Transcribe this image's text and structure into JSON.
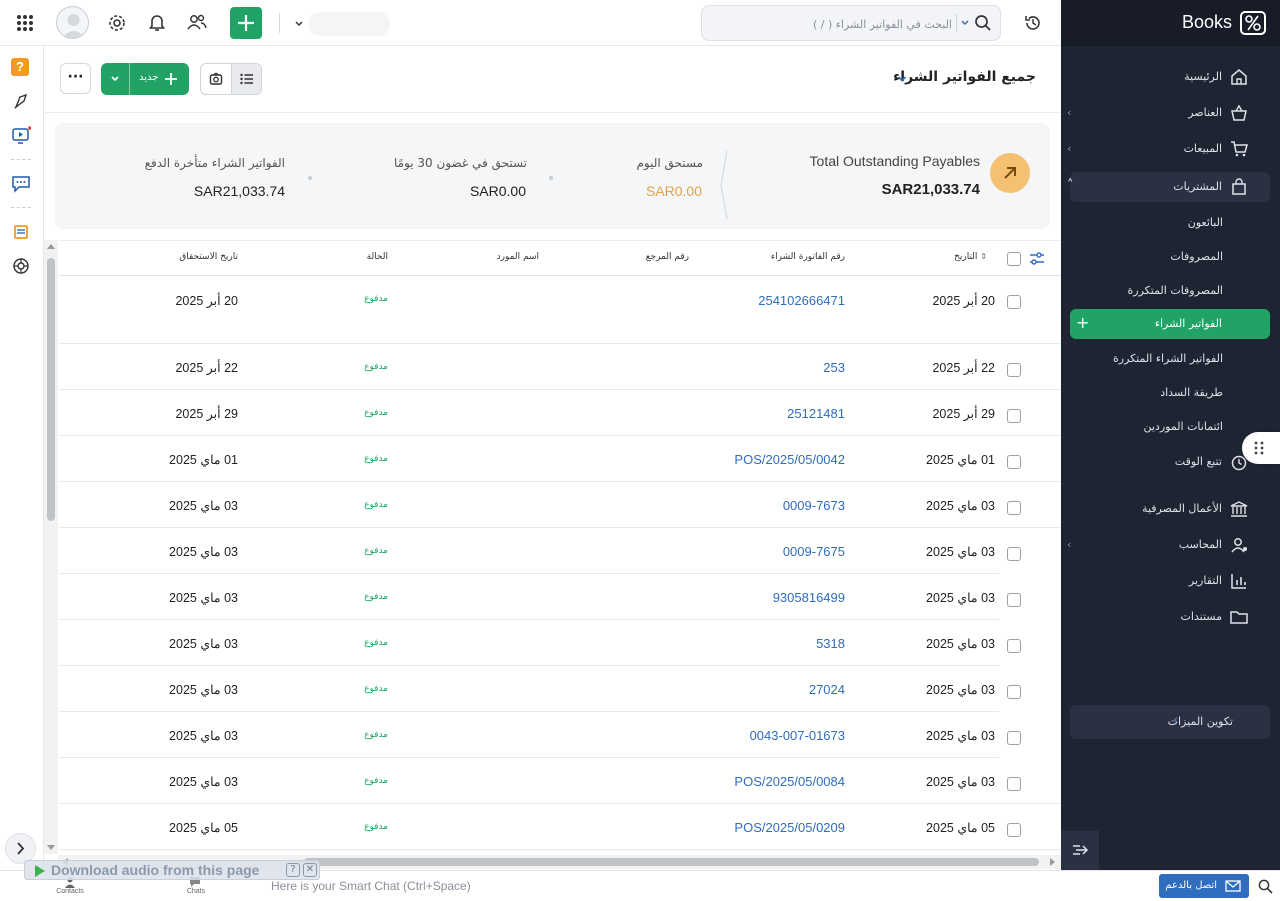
{
  "app": {
    "name": "Books"
  },
  "colors": {
    "accent": "#21a366",
    "link": "#2f6dbf",
    "sidebar_bg": "#1f2433",
    "overdue": "#e5a14a"
  },
  "topbar": {
    "search_placeholder": "البحث في الفواتير الشراء ( / )",
    "icons": [
      "apps-grid-icon",
      "avatar",
      "gear-icon",
      "bell-icon",
      "users-icon",
      "plus-icon",
      "history-icon",
      "search-icon"
    ]
  },
  "sidebar": {
    "items": [
      {
        "label": "الرئيسية",
        "icon": "home-icon"
      },
      {
        "label": "العناصر",
        "icon": "basket-icon",
        "chevron": "‹"
      },
      {
        "label": "المبيعات",
        "icon": "cart-icon",
        "chevron": "‹"
      },
      {
        "label": "المشتريات",
        "icon": "bag-icon",
        "chevron": "˄"
      }
    ],
    "purchases_sub": [
      {
        "label": "البائعون"
      },
      {
        "label": "المصروفات"
      },
      {
        "label": "المصروفات المتكررة"
      },
      {
        "label": "الفواتير الشراء",
        "plus": "+"
      },
      {
        "label": "الفواتير الشراء المتكررة"
      },
      {
        "label": "طريقة السداد"
      },
      {
        "label": "ائتمانات الموردين"
      }
    ],
    "items2": [
      {
        "label": "تتبع الوقت",
        "icon": "clock-icon"
      },
      {
        "label": "الأعمال المصرفية",
        "icon": "bank-icon"
      },
      {
        "label": "المحاسب",
        "icon": "accountant-icon",
        "chevron": "‹"
      },
      {
        "label": "التقارير",
        "icon": "bar-chart-icon"
      },
      {
        "label": "مستندات",
        "icon": "folder-icon"
      }
    ],
    "config": {
      "label": "تكوين الميزات",
      "chevron": "‹"
    }
  },
  "header": {
    "title": "جميع الفواتير الشراء",
    "new_label": "جديد",
    "more_label": "···"
  },
  "summary": {
    "total_label": "Total Outstanding Payables",
    "total_value": "SAR21,033.74",
    "due_today_label": "مستحق اليوم",
    "due_today_value": "SAR0.00",
    "due_30_label": "تستحق في غضون 30 يومًا",
    "due_30_value": "SAR0.00",
    "overdue_label": "الفواتير الشراء متأخرة الدفع",
    "overdue_value": "SAR21,033.74"
  },
  "table": {
    "columns": {
      "date": "التاريخ",
      "invoice": "رقم الفاتورة الشراء",
      "reference": "رقم المرجع",
      "vendor": "اسم المورد",
      "status": "الحالة",
      "due": "تاريخ الاستحقاق"
    },
    "rows": [
      {
        "date": "20 أبر 2025",
        "invoice": "254102666471",
        "status": "مدفوع",
        "due": "20 أبر 2025"
      },
      {
        "date": "22 أبر 2025",
        "invoice": "253",
        "status": "مدفوع",
        "due": "22 أبر 2025"
      },
      {
        "date": "29 أبر 2025",
        "invoice": "25121481",
        "status": "مدفوع",
        "due": "29 أبر 2025"
      },
      {
        "date": "01 ماي 2025",
        "invoice": "POS/2025/05/0042",
        "status": "مدفوع",
        "due": "01 ماي 2025"
      },
      {
        "date": "03 ماي 2025",
        "invoice": "0009-7673",
        "status": "مدفوع",
        "due": "03 ماي 2025"
      },
      {
        "date": "03 ماي 2025",
        "invoice": "0009-7675",
        "status": "مدفوع",
        "due": "03 ماي 2025"
      },
      {
        "date": "03 ماي 2025",
        "invoice": "9305816499",
        "status": "مدفوع",
        "due": "03 ماي 2025"
      },
      {
        "date": "03 ماي 2025",
        "invoice": "5318",
        "status": "مدفوع",
        "due": "03 ماي 2025"
      },
      {
        "date": "03 ماي 2025",
        "invoice": "27024",
        "status": "مدفوع",
        "due": "03 ماي 2025"
      },
      {
        "date": "03 ماي 2025",
        "invoice": "0043-007-01673",
        "status": "مدفوع",
        "due": "03 ماي 2025"
      },
      {
        "date": "03 ماي 2025",
        "invoice": "POS/2025/05/0084",
        "status": "مدفوع",
        "due": "03 ماي 2025"
      },
      {
        "date": "05 ماي 2025",
        "invoice": "POS/2025/05/0209",
        "status": "مدفوع",
        "due": "05 ماي 2025"
      }
    ]
  },
  "bottombar": {
    "download_text": "Download audio from this page",
    "chat_placeholder": "Here is your Smart Chat (Ctrl+Space)",
    "contacts": "Contacts",
    "chats": "Chats",
    "support": "اتصل بالدعم"
  }
}
